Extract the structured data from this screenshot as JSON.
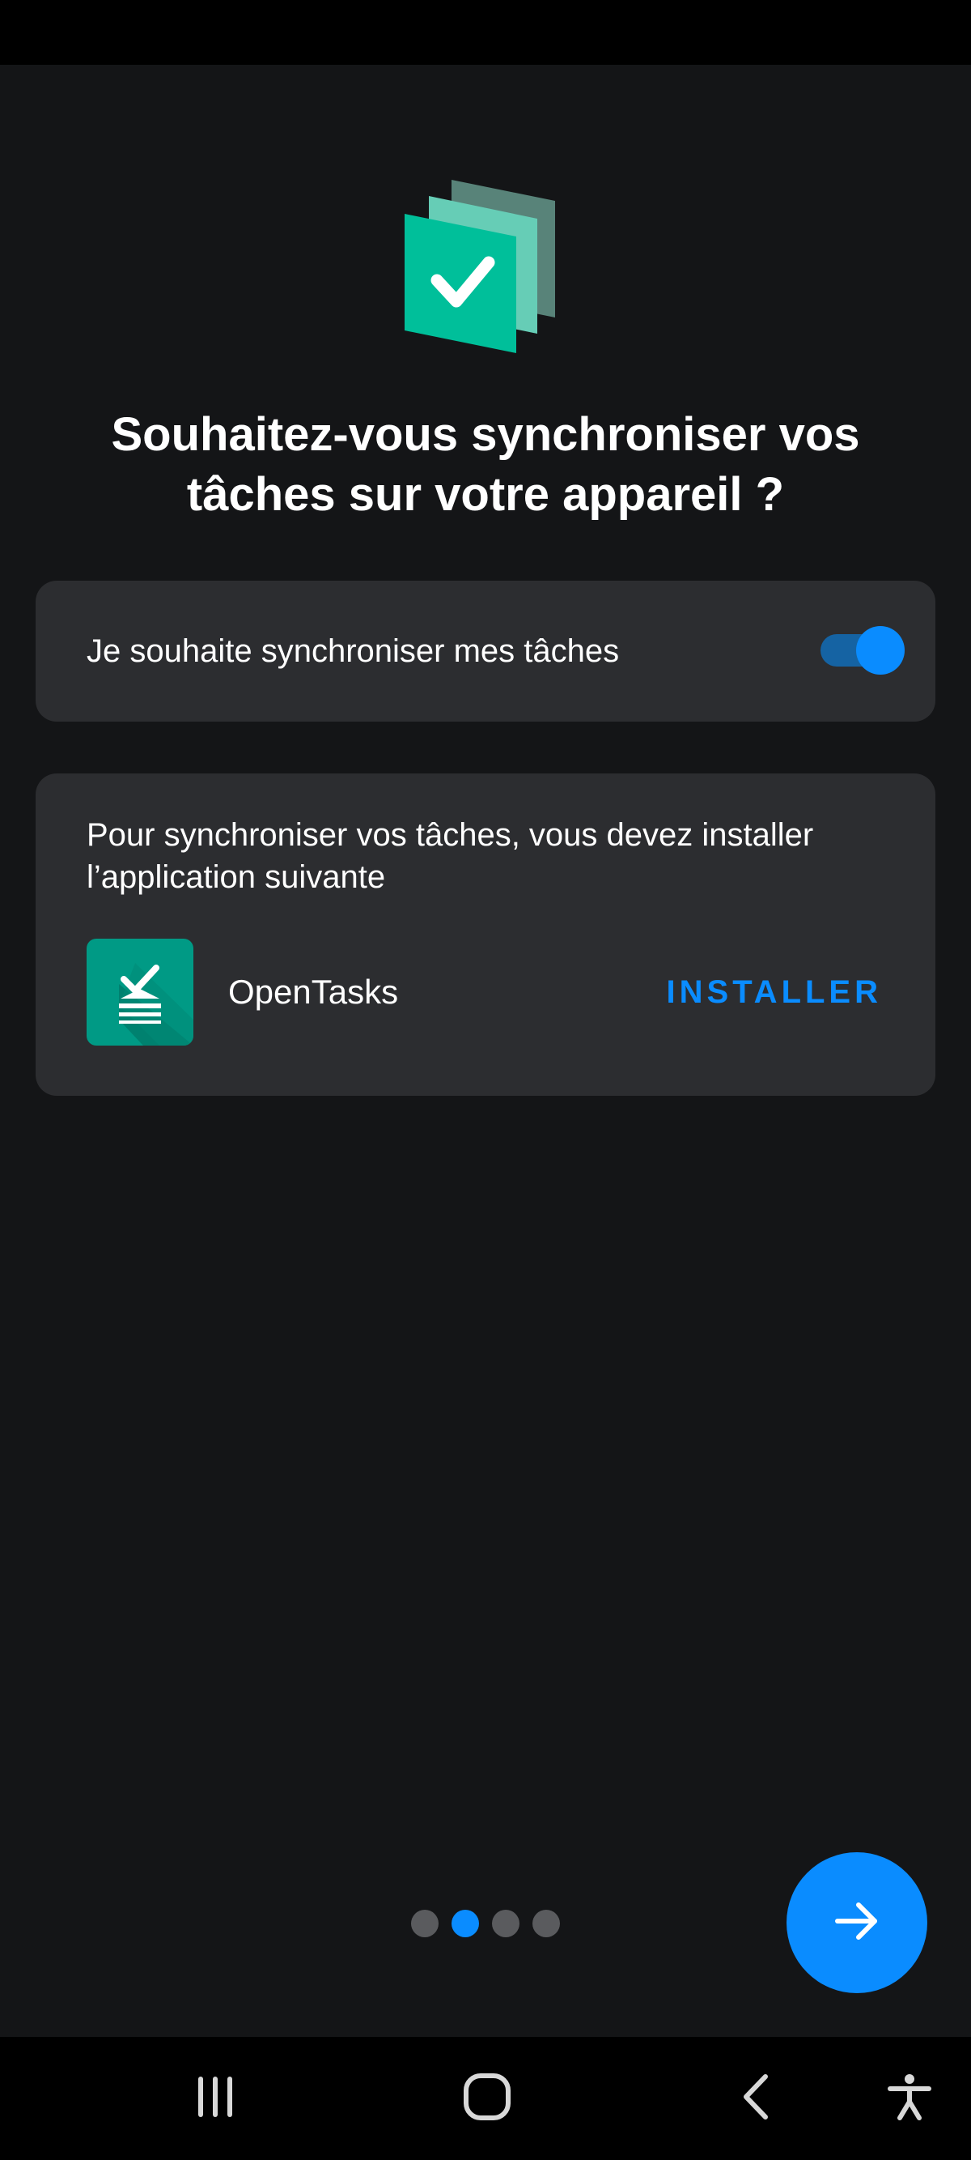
{
  "onboarding": {
    "title": "Souhaitez-vous synchroniser vos tâches sur votre appareil ?"
  },
  "sync_card": {
    "label": "Je souhaite synchroniser mes tâches",
    "toggle_on": true
  },
  "install_card": {
    "description": "Pour synchroniser vos tâches, vous devez installer l’application suivante",
    "app_name": "OpenTasks",
    "install_label": "INSTALLER"
  },
  "pager": {
    "page_count": 4,
    "current_page": 2
  },
  "icons": {
    "hero": "stacked-tasks-check-icon",
    "app": "opentasks-app-icon",
    "next": "arrow-right-icon",
    "nav_recent": "recent-apps-icon",
    "nav_home": "home-icon",
    "nav_back": "back-icon",
    "nav_accessibility": "accessibility-icon"
  },
  "colors": {
    "accent": "#0a8cff",
    "brand_teal": "#00bf9a",
    "background": "#141517",
    "card": "#2c2d30"
  }
}
